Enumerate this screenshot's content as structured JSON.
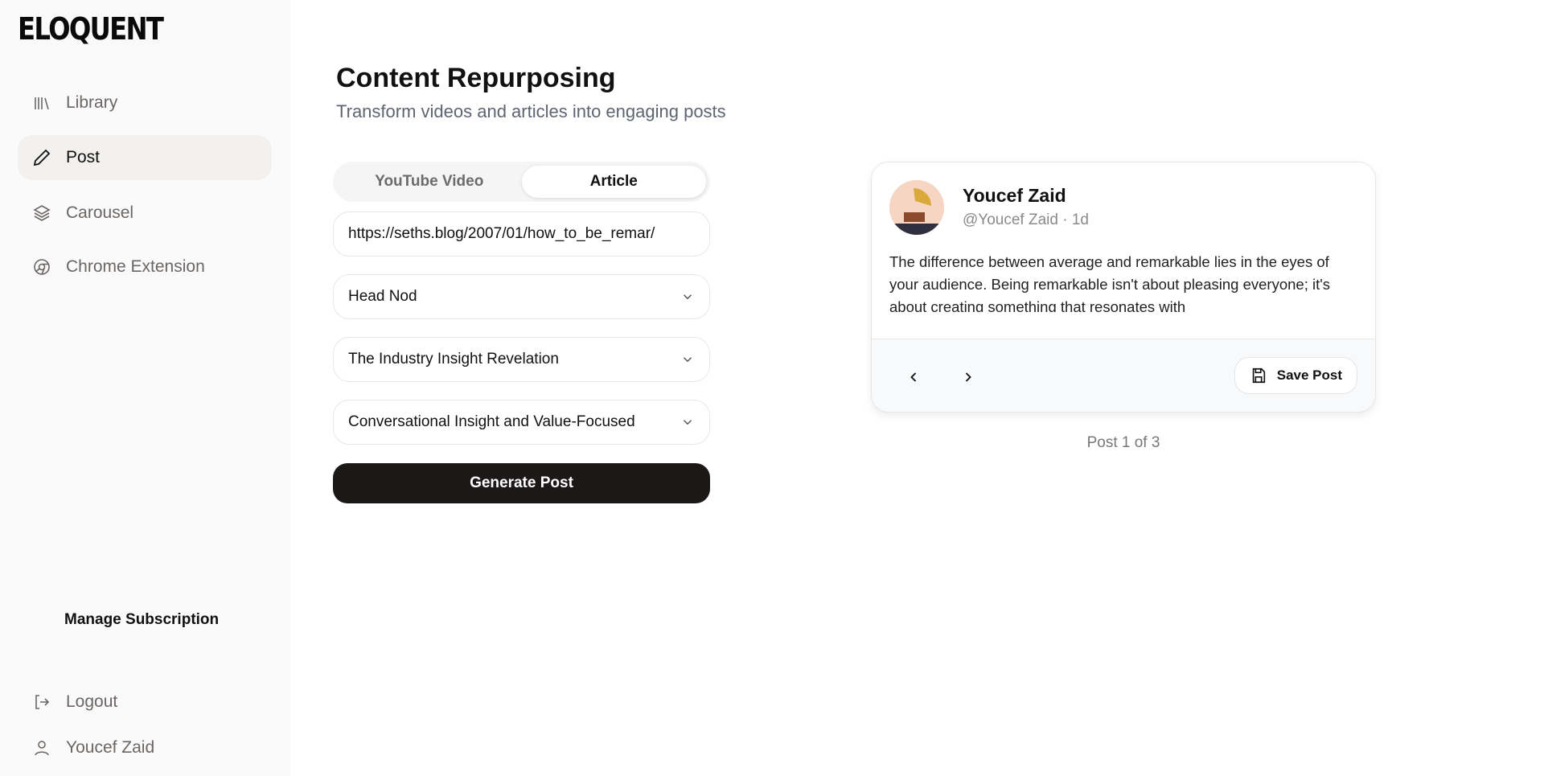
{
  "sidebar": {
    "logo": "ELOQUENT",
    "items": [
      {
        "label": "Library",
        "icon": "library-icon"
      },
      {
        "label": "Post",
        "icon": "pencil-icon",
        "active": true
      },
      {
        "label": "Carousel",
        "icon": "layers-icon"
      },
      {
        "label": "Chrome Extension",
        "icon": "chrome-icon"
      }
    ],
    "manage_subscription": "Manage Subscription",
    "logout": "Logout",
    "user": "Youcef Zaid"
  },
  "main": {
    "title": "Content Repurposing",
    "subtitle": "Transform videos and articles into engaging posts",
    "tabs": [
      {
        "label": "YouTube Video"
      },
      {
        "label": "Article",
        "active": true
      }
    ],
    "url_value": "https://seths.blog/2007/01/how_to_be_remar/",
    "select_1": "Head Nod",
    "select_2": "The Industry Insight Revelation",
    "select_3": "Conversational Insight and Value-Focused",
    "generate_label": "Generate Post"
  },
  "preview": {
    "name": "Youcef Zaid",
    "handle": "@Youcef Zaid · 1d",
    "body": "The difference between average and remarkable lies in the eyes of your audience. Being remarkable isn't about pleasing everyone; it's about creating something that resonates with",
    "save_label": "Save Post",
    "counter": "Post 1 of 3"
  }
}
